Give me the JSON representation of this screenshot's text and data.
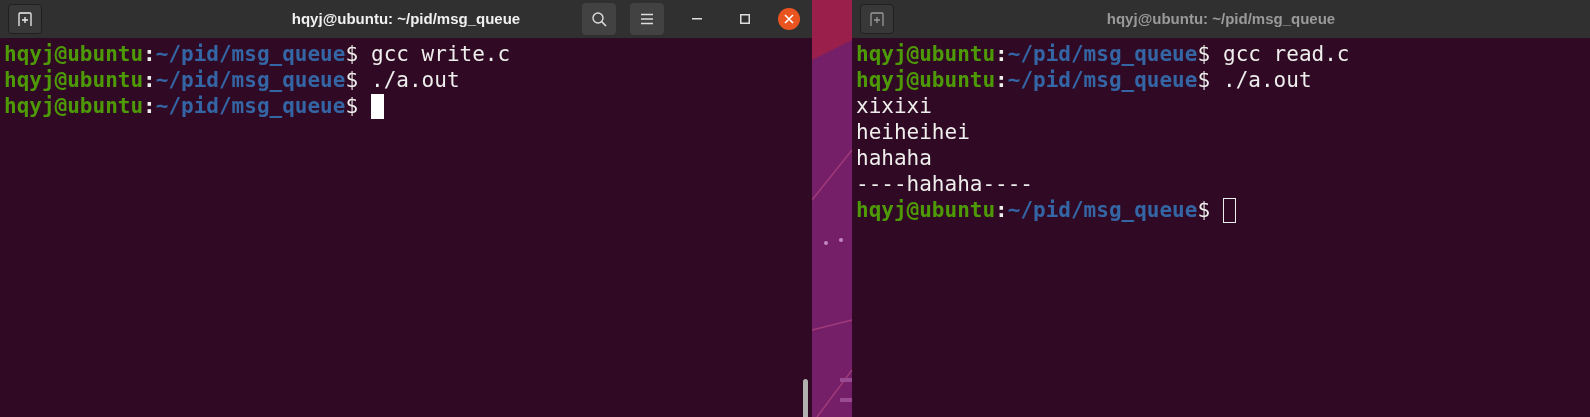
{
  "windows": [
    {
      "title": "hqyj@ubuntu: ~/pid/msg_queue",
      "active": true,
      "lines": [
        {
          "kind": "prompt",
          "user": "hqyj@ubuntu",
          "sep": ":",
          "path": "~/pid/msg_queue",
          "symbol": "$",
          "command": "gcc write.c"
        },
        {
          "kind": "prompt",
          "user": "hqyj@ubuntu",
          "sep": ":",
          "path": "~/pid/msg_queue",
          "symbol": "$",
          "command": "./a.out"
        },
        {
          "kind": "prompt",
          "user": "hqyj@ubuntu",
          "sep": ":",
          "path": "~/pid/msg_queue",
          "symbol": "$",
          "cursor": true
        }
      ]
    },
    {
      "title": "hqyj@ubuntu: ~/pid/msg_queue",
      "active": false,
      "lines": [
        {
          "kind": "prompt",
          "user": "hqyj@ubuntu",
          "sep": ":",
          "path": "~/pid/msg_queue",
          "symbol": "$",
          "command": "gcc read.c"
        },
        {
          "kind": "prompt",
          "user": "hqyj@ubuntu",
          "sep": ":",
          "path": "~/pid/msg_queue",
          "symbol": "$",
          "command": "./a.out"
        },
        {
          "kind": "output",
          "text": "xixixi"
        },
        {
          "kind": "output",
          "text": "heiheihei"
        },
        {
          "kind": "output",
          "text": "hahaha"
        },
        {
          "kind": "output",
          "text": "----hahaha----"
        },
        {
          "kind": "prompt",
          "user": "hqyj@ubuntu",
          "sep": ":",
          "path": "~/pid/msg_queue",
          "symbol": "$",
          "cursor": true
        }
      ]
    }
  ]
}
